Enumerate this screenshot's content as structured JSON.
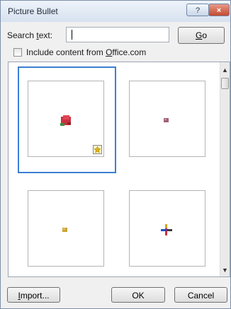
{
  "window": {
    "title": "Picture Bullet",
    "help_icon": "?",
    "close_icon": "×"
  },
  "search": {
    "label_pre": "Search ",
    "label_access": "t",
    "label_post": "ext:",
    "value": "",
    "go_access": "G",
    "go_rest": "o"
  },
  "options": {
    "include_pre": "Include content from ",
    "include_access": "O",
    "include_post": "ffice.com",
    "checked": false
  },
  "gallery": {
    "items": [
      {
        "name": "red-rose-bullet",
        "selected": true
      },
      {
        "name": "purple-square-bullet",
        "selected": false
      },
      {
        "name": "gold-square-bullet",
        "selected": false
      },
      {
        "name": "cross-bullet",
        "selected": false
      }
    ]
  },
  "footer": {
    "import_access": "I",
    "import_rest": "mport...",
    "ok_label": "OK",
    "cancel_label": "Cancel"
  },
  "colors": {
    "accent": "#3b7fd1",
    "close_red": "#c44a30"
  }
}
